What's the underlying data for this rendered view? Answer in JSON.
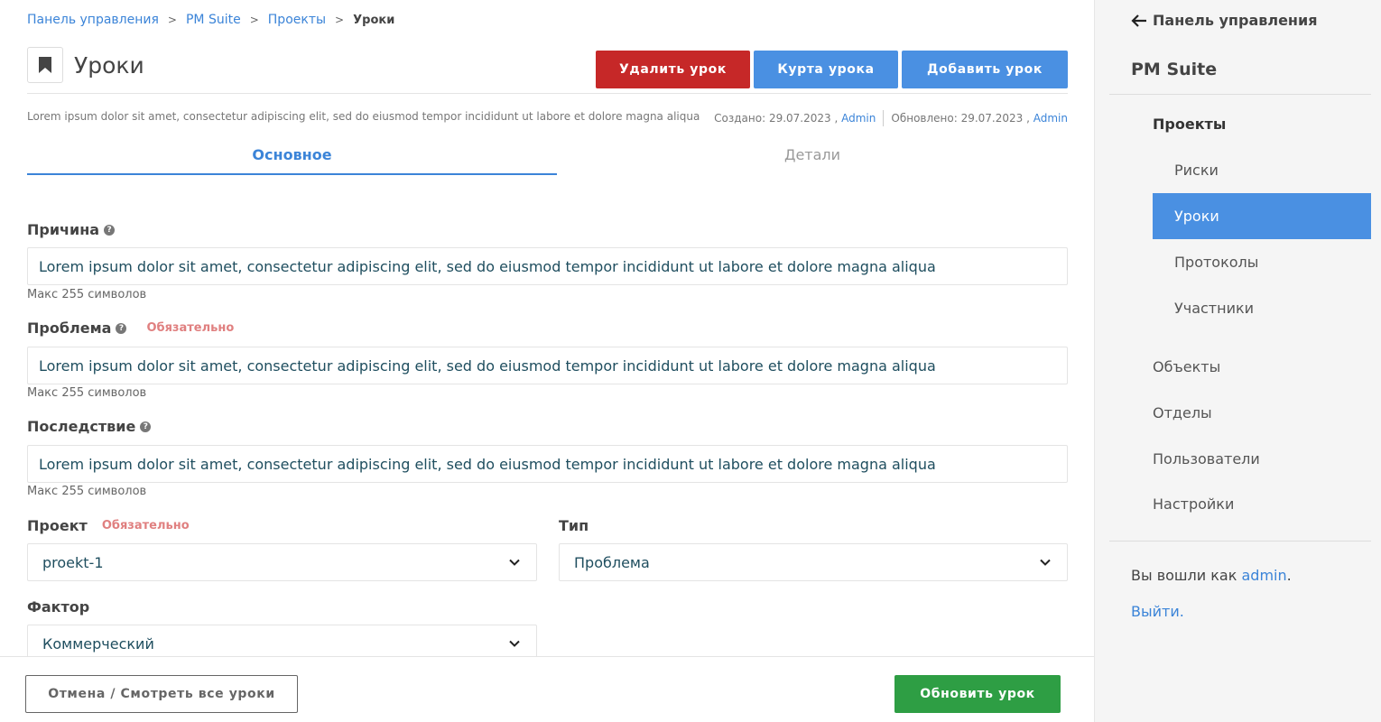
{
  "breadcrumb": [
    {
      "label": "Панель управления"
    },
    {
      "label": "PM Suite"
    },
    {
      "label": "Проекты"
    }
  ],
  "breadcrumb_current": "Уроки",
  "breadcrumb_sep": ">",
  "page": {
    "title": "Уроки",
    "icon": "bookmark-icon",
    "description": "Lorem ipsum dolor sit amet, consectetur adipiscing elit, sed do eiusmod tempor incididunt ut labore et dolore magna aliqua"
  },
  "actions": {
    "delete": "Удалить урок",
    "curate": "Курта урока",
    "add": "Добавить урок"
  },
  "meta": {
    "created_label": "Создано: 29.07.2023 ,",
    "created_by": "Admin",
    "updated_label": "Обновлено: 29.07.2023 ,",
    "updated_by": "Admin"
  },
  "tabs": {
    "main": "Основное",
    "details": "Детали"
  },
  "form": {
    "cause": {
      "label": "Причина",
      "value": "Lorem ipsum dolor sit amet, consectetur adipiscing elit, sed do eiusmod tempor incididunt ut labore et dolore magna aliqua",
      "hint": "Макс 255 символов"
    },
    "problem": {
      "label": "Проблема",
      "required": "Обязательно",
      "value": "Lorem ipsum dolor sit amet, consectetur adipiscing elit, sed do eiusmod tempor incididunt ut labore et dolore magna aliqua",
      "hint": "Макс 255 символов"
    },
    "consequence": {
      "label": "Последствие",
      "value": "Lorem ipsum dolor sit amet, consectetur adipiscing elit, sed do eiusmod tempor incididunt ut labore et dolore magna aliqua",
      "hint": "Макс 255 символов"
    },
    "project": {
      "label": "Проект",
      "required": "Обязательно",
      "value": "proekt-1"
    },
    "type": {
      "label": "Тип",
      "value": "Проблема"
    },
    "factor": {
      "label": "Фактор",
      "value": "Коммерческий"
    }
  },
  "footer": {
    "cancel": "Отмена / Смотреть все уроки",
    "update": "Обновить урок"
  },
  "sidebar": {
    "back": "Панель управления",
    "suite": "PM Suite",
    "projects": "Проекты",
    "project_items": [
      "Риски",
      "Уроки",
      "Протоколы",
      "Участники"
    ],
    "active_item": "Уроки",
    "items": [
      "Объекты",
      "Отделы",
      "Пользователи",
      "Настройки"
    ],
    "logged_in_prefix": "Вы вошли как",
    "logged_in_user": "admin",
    "logged_in_suffix": ".",
    "logout": "Выйти."
  },
  "colors": {
    "accent": "#4a90e2",
    "danger": "#c62828",
    "success": "#2e9e44",
    "required": "#e08080"
  }
}
